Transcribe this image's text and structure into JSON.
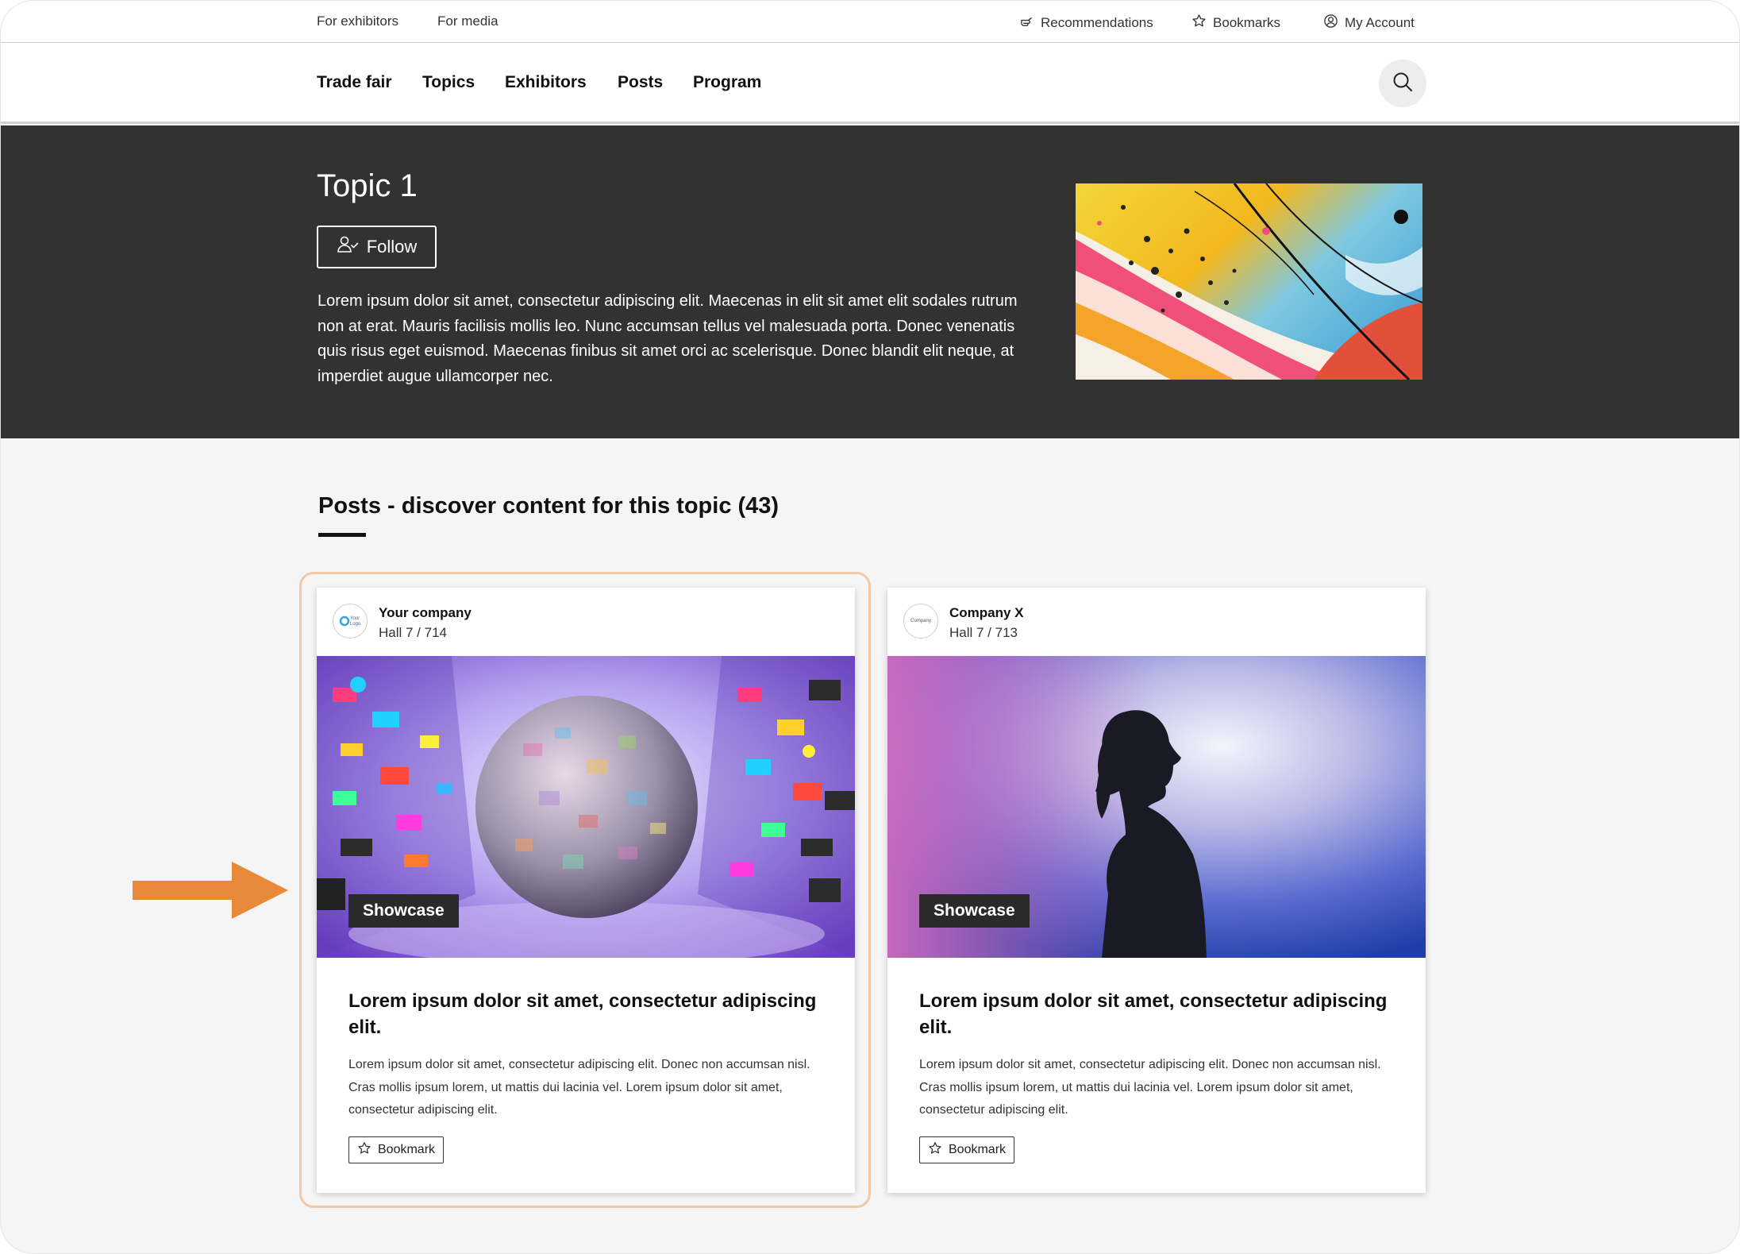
{
  "utility_nav": {
    "for_exhibitors": "For exhibitors",
    "for_media": "For media",
    "recommendations": "Recommendations",
    "bookmarks": "Bookmarks",
    "my_account": "My Account"
  },
  "main_nav": {
    "items": [
      {
        "label": "Trade fair"
      },
      {
        "label": "Topics"
      },
      {
        "label": "Exhibitors"
      },
      {
        "label": "Posts"
      },
      {
        "label": "Program"
      }
    ]
  },
  "hero": {
    "title": "Topic 1",
    "follow_label": "Follow",
    "description": "Lorem ipsum dolor sit amet, consectetur adipiscing elit. Maecenas in elit sit amet elit sodales rutrum non at erat. Mauris facilisis mollis leo. Nunc accumsan tellus vel malesuada porta. Donec venenatis quis risus eget euismod. Maecenas finibus sit amet orci ac scelerisque. Donec blandit elit neque, at imperdiet augue ullamcorper nec."
  },
  "posts": {
    "section_title": "Posts - discover content for this topic (43)",
    "cards": [
      {
        "company": "Your company",
        "hall": "Hall 7 / 714",
        "badge": "Showcase",
        "title": "Lorem ipsum dolor sit amet, consectetur adipiscing elit.",
        "excerpt": "Lorem ipsum dolor sit amet, consectetur adipiscing elit. Donec non accumsan nisl. Cras mollis ipsum lorem, ut mattis dui lacinia vel. Lorem ipsum dolor sit amet, consectetur adipiscing elit.",
        "bookmark_label": "Bookmark",
        "logo_text": "Your Logo"
      },
      {
        "company": "Company X",
        "hall": "Hall 7 / 713",
        "badge": "Showcase",
        "title": "Lorem ipsum dolor sit amet, consectetur adipiscing elit.",
        "excerpt": "Lorem ipsum dolor sit amet, consectetur adipiscing elit. Donec non accumsan nisl. Cras mollis ipsum lorem, ut mattis dui lacinia vel. Lorem ipsum dolor sit amet, consectetur adipiscing elit.",
        "bookmark_label": "Bookmark",
        "logo_text": "Company"
      }
    ]
  },
  "colors": {
    "hero_bg": "#323232",
    "page_bg": "#f5f5f6",
    "highlight_border": "#f2c9a7",
    "annotation_arrow": "#e8893a"
  }
}
